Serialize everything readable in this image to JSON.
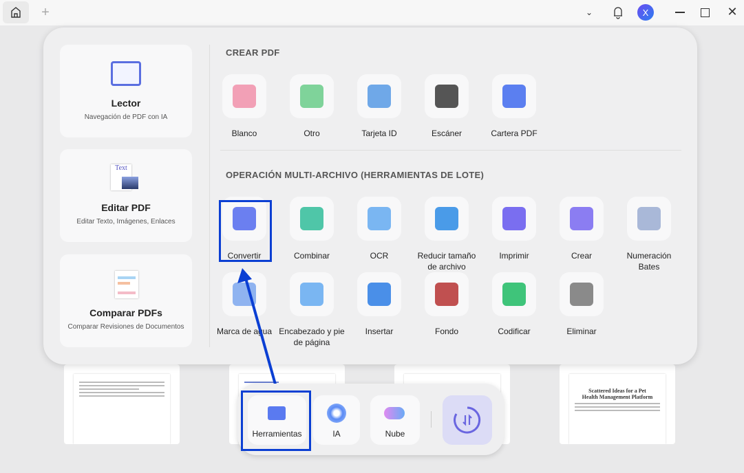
{
  "topbar": {
    "avatar_letter": "X"
  },
  "background_docs": [
    {
      "title": "Scattered Ideas for a Pet Health Management Platform"
    }
  ],
  "left_cards": [
    {
      "title": "Lector",
      "subtitle": "Navegación de PDF con IA"
    },
    {
      "title": "Editar PDF",
      "subtitle": "Editar Texto, Imágenes, Enlaces",
      "icon_text": "Text"
    },
    {
      "title": "Comparar PDFs",
      "subtitle": "Comparar Revisiones de Documentos"
    }
  ],
  "create_section": {
    "title": "CREAR PDF",
    "items": [
      {
        "label": "Blanco",
        "color": "#f2a0b6"
      },
      {
        "label": "Otro",
        "color": "#7fd39a"
      },
      {
        "label": "Tarjeta ID",
        "color": "#6fa8e8"
      },
      {
        "label": "Escáner",
        "color": "#555555"
      },
      {
        "label": "Cartera PDF",
        "color": "#5b7ff0"
      }
    ]
  },
  "batch_section": {
    "title": "OPERACIÓN MULTI-ARCHIVO (HERRAMIENTAS DE LOTE)",
    "items": [
      {
        "label": "Convertir",
        "color": "#6b7ff0"
      },
      {
        "label": "Combinar",
        "color": "#4fc6a8"
      },
      {
        "label": "OCR",
        "color": "#7ab6f2"
      },
      {
        "label": "Reducir tamaño de archivo",
        "color": "#4a9be8"
      },
      {
        "label": "Imprimir",
        "color": "#7a6ef0"
      },
      {
        "label": "Crear",
        "color": "#8b7df2"
      },
      {
        "label": "Numeración Bates",
        "color": "#a9b8d8"
      },
      {
        "label": "Marca de agua",
        "color": "#8fb3f0"
      },
      {
        "label": "Encabezado y pie de página",
        "color": "#7ab6f2"
      },
      {
        "label": "Insertar",
        "color": "#4a8fe8"
      },
      {
        "label": "Fondo",
        "color": "#c05050"
      },
      {
        "label": "Codificar",
        "color": "#3fc47a"
      },
      {
        "label": "Eliminar",
        "color": "#8a8a8a"
      }
    ]
  },
  "dock": {
    "items": [
      {
        "label": "Herramientas"
      },
      {
        "label": "IA"
      },
      {
        "label": "Nube"
      }
    ]
  },
  "colors": {
    "highlight": "#0b3fd3",
    "accent": "#5b5ff0"
  }
}
